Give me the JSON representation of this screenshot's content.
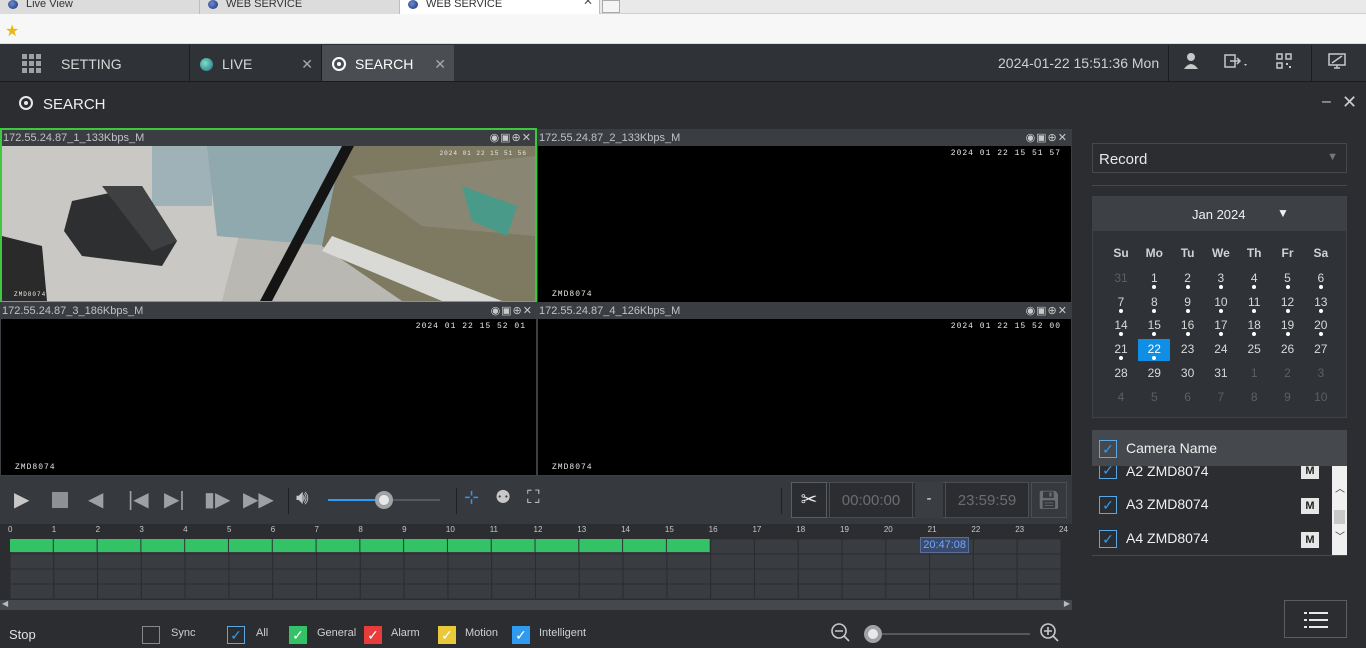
{
  "browser": {
    "tabs": [
      {
        "label": "Live View"
      },
      {
        "label": "WEB SERVICE"
      },
      {
        "label": "WEB SERVICE"
      }
    ]
  },
  "header": {
    "setting_label": "SETTING",
    "tabs": [
      {
        "label": "LIVE"
      },
      {
        "label": "SEARCH"
      }
    ],
    "datetime": "2024-01-22 15:51:36 Mon"
  },
  "window": {
    "title": "SEARCH"
  },
  "video": {
    "cells": [
      {
        "caption": "172.55.24.87_1_133Kbps_M",
        "stamp": "2024 01 22 15 51 56",
        "camera": "ZMD8074"
      },
      {
        "caption": "172.55.24.87_2_133Kbps_M",
        "stamp": "2024 01 22 15 51 57",
        "camera": "ZMD8074"
      },
      {
        "caption": "172.55.24.87_3_186Kbps_M",
        "stamp": "2024 01 22 15 52 01",
        "camera": "ZMD8074"
      },
      {
        "caption": "172.55.24.87_4_126Kbps_M",
        "stamp": "2024 01 22 15 52 00",
        "camera": "ZMD8074"
      }
    ]
  },
  "controls": {
    "start_time": "00:00:00",
    "separator": "-",
    "end_time": "23:59:59",
    "volume_level": 0.5
  },
  "timeline": {
    "hours": [
      "0",
      "1",
      "2",
      "3",
      "4",
      "5",
      "6",
      "7",
      "8",
      "9",
      "10",
      "11",
      "12",
      "13",
      "14",
      "15",
      "16",
      "17",
      "18",
      "19",
      "20",
      "21",
      "22",
      "23",
      "24"
    ],
    "record_end_hour": 16,
    "cursor_time": "20:47:08"
  },
  "bottom": {
    "status": "Stop",
    "sync_label": "Sync",
    "all_label": "All",
    "general_label": "General",
    "alarm_label": "Alarm",
    "motion_label": "Motion",
    "intelligent_label": "Intelligent",
    "colors": {
      "general": "#33c266",
      "alarm": "#e83c3c",
      "motion": "#e9c83a",
      "intelligent": "#2f9bf0"
    }
  },
  "panel": {
    "record_type": "Record",
    "calendar": {
      "month": "Jan 2024",
      "weekdays": [
        "Su",
        "Mo",
        "Tu",
        "We",
        "Th",
        "Fr",
        "Sa"
      ],
      "rows": [
        [
          "31",
          "1",
          "2",
          "3",
          "4",
          "5",
          "6"
        ],
        [
          "7",
          "8",
          "9",
          "10",
          "11",
          "12",
          "13"
        ],
        [
          "14",
          "15",
          "16",
          "17",
          "18",
          "19",
          "20"
        ],
        [
          "21",
          "22",
          "23",
          "24",
          "25",
          "26",
          "27"
        ],
        [
          "28",
          "29",
          "30",
          "31",
          "1",
          "2",
          "3"
        ],
        [
          "4",
          "5",
          "6",
          "7",
          "8",
          "9",
          "10"
        ]
      ],
      "selected": "22"
    },
    "camera_header": "Camera Name",
    "cameras": [
      {
        "name": "A2 ZMD8074",
        "mark": "M"
      },
      {
        "name": "A3 ZMD8074",
        "mark": "M"
      },
      {
        "name": "A4 ZMD8074",
        "mark": "M"
      }
    ]
  }
}
